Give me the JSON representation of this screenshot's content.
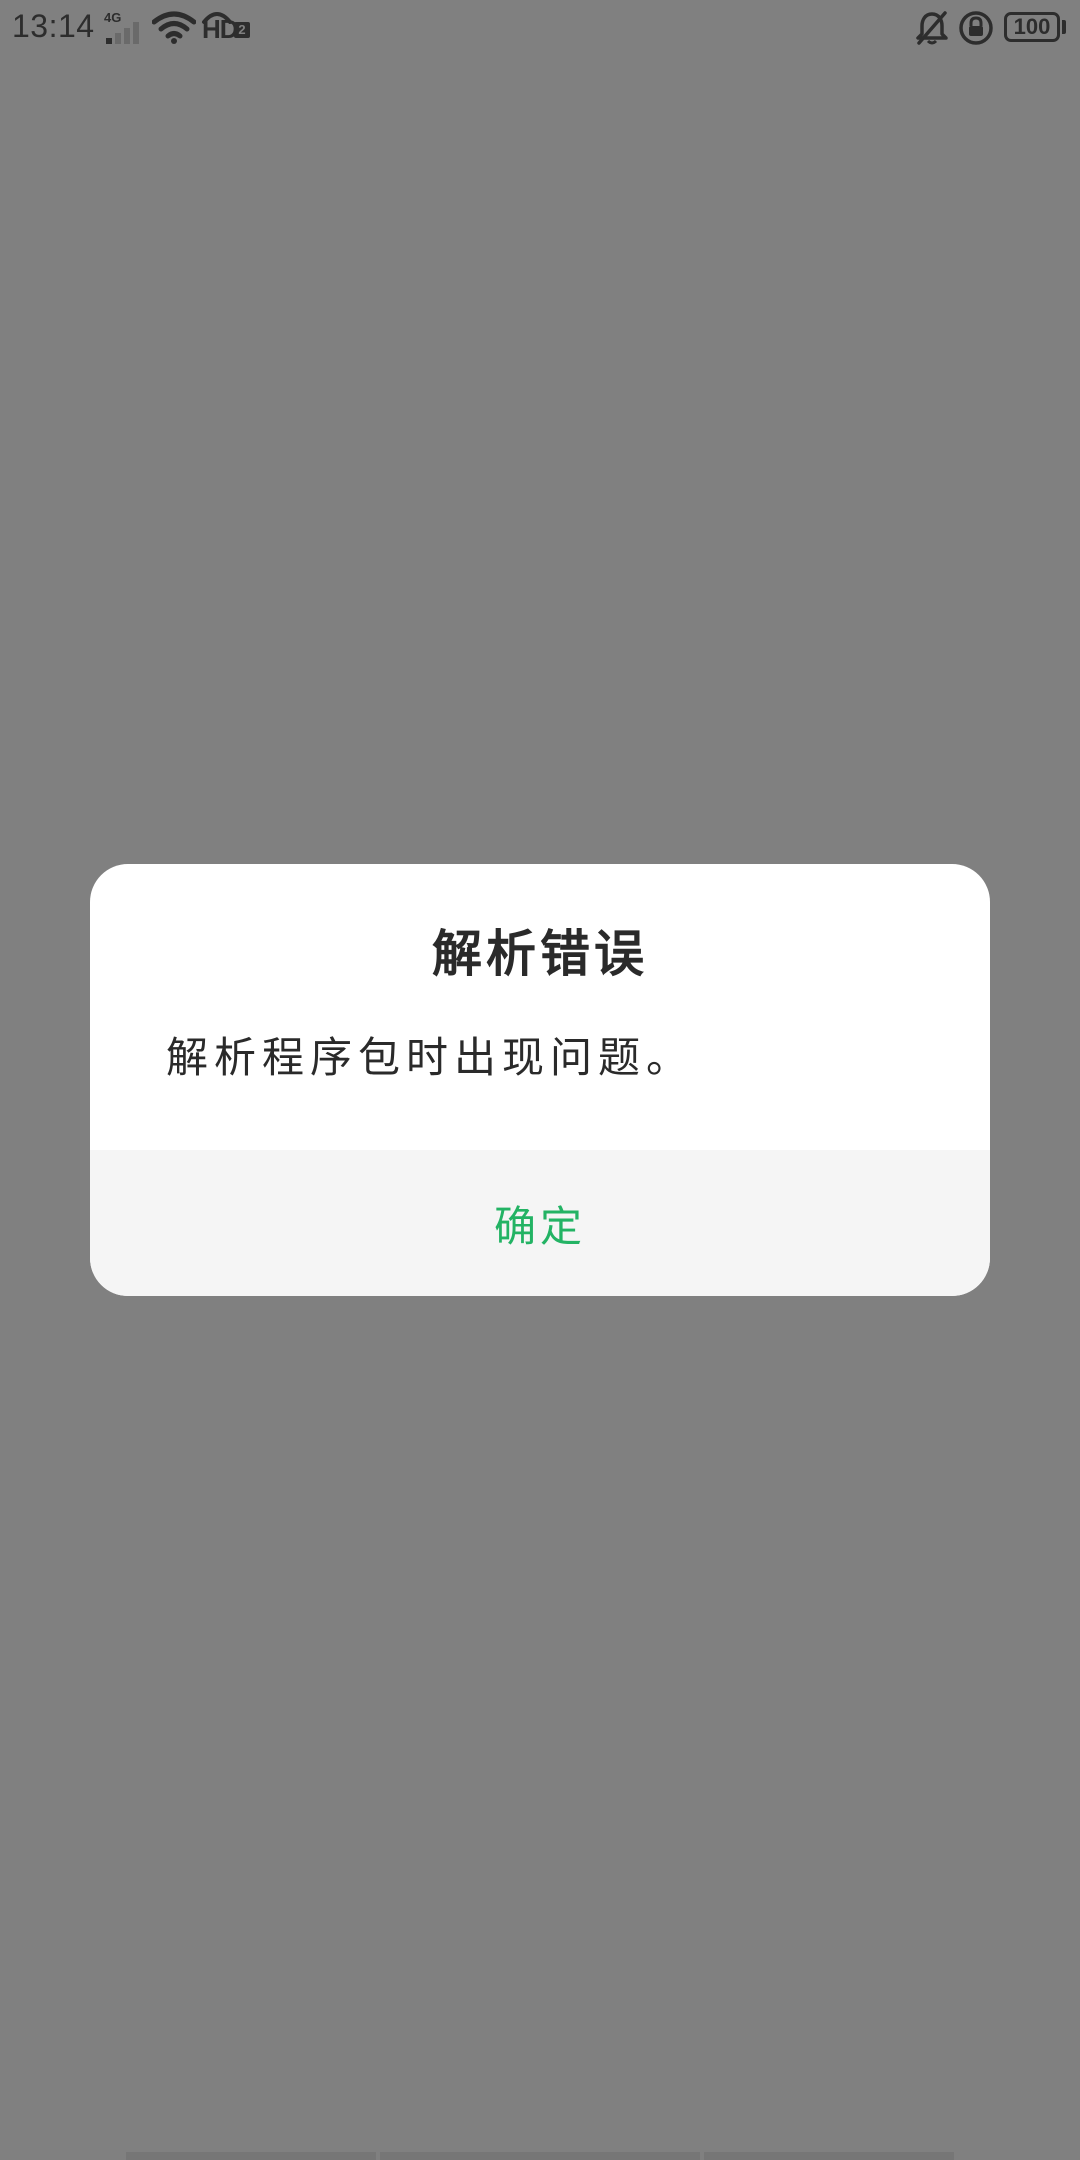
{
  "status_bar": {
    "time": "13:14",
    "network_type": "4G",
    "hd_label": "HD",
    "hd_sub": "2",
    "battery_level": "100",
    "icons": [
      "signal-icon",
      "wifi-icon",
      "hd-voice-icon",
      "bell-off-icon",
      "rotation-lock-icon",
      "battery-icon"
    ]
  },
  "dialog": {
    "title": "解析错误",
    "message": "解析程序包时出现问题。",
    "confirm_label": "确定",
    "accent_color": "#23b364"
  },
  "colors": {
    "scrim": "#808080",
    "dialog_bg": "#ffffff",
    "footer_bg": "#f5f5f5",
    "text": "#2a2a2a"
  }
}
